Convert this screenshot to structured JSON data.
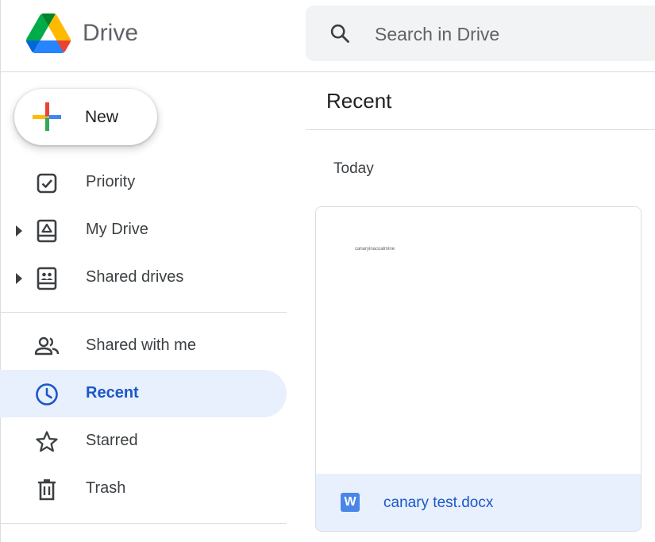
{
  "header": {
    "app_title": "Drive",
    "search_placeholder": "Search in Drive"
  },
  "sidebar": {
    "new_label": "New",
    "items": [
      {
        "label": "Priority",
        "icon": "priority-icon"
      },
      {
        "label": "My Drive",
        "icon": "my-drive-icon"
      },
      {
        "label": "Shared drives",
        "icon": "shared-drives-icon"
      },
      {
        "label": "Shared with me",
        "icon": "people-icon"
      },
      {
        "label": "Recent",
        "icon": "clock-icon",
        "active": true
      },
      {
        "label": "Starred",
        "icon": "star-icon"
      },
      {
        "label": "Trash",
        "icon": "trash-icon"
      }
    ]
  },
  "main": {
    "title": "Recent",
    "section": "Today",
    "files": [
      {
        "name": "canary test.docx",
        "preview_text": "canaryinacoalmine",
        "type_badge": "W",
        "icon": "word-doc-icon"
      }
    ]
  },
  "colors": {
    "accent": "#1a57c8",
    "active_bg": "#e8f0fe",
    "search_bg": "#f1f3f4",
    "word_blue": "#4a86e8"
  }
}
